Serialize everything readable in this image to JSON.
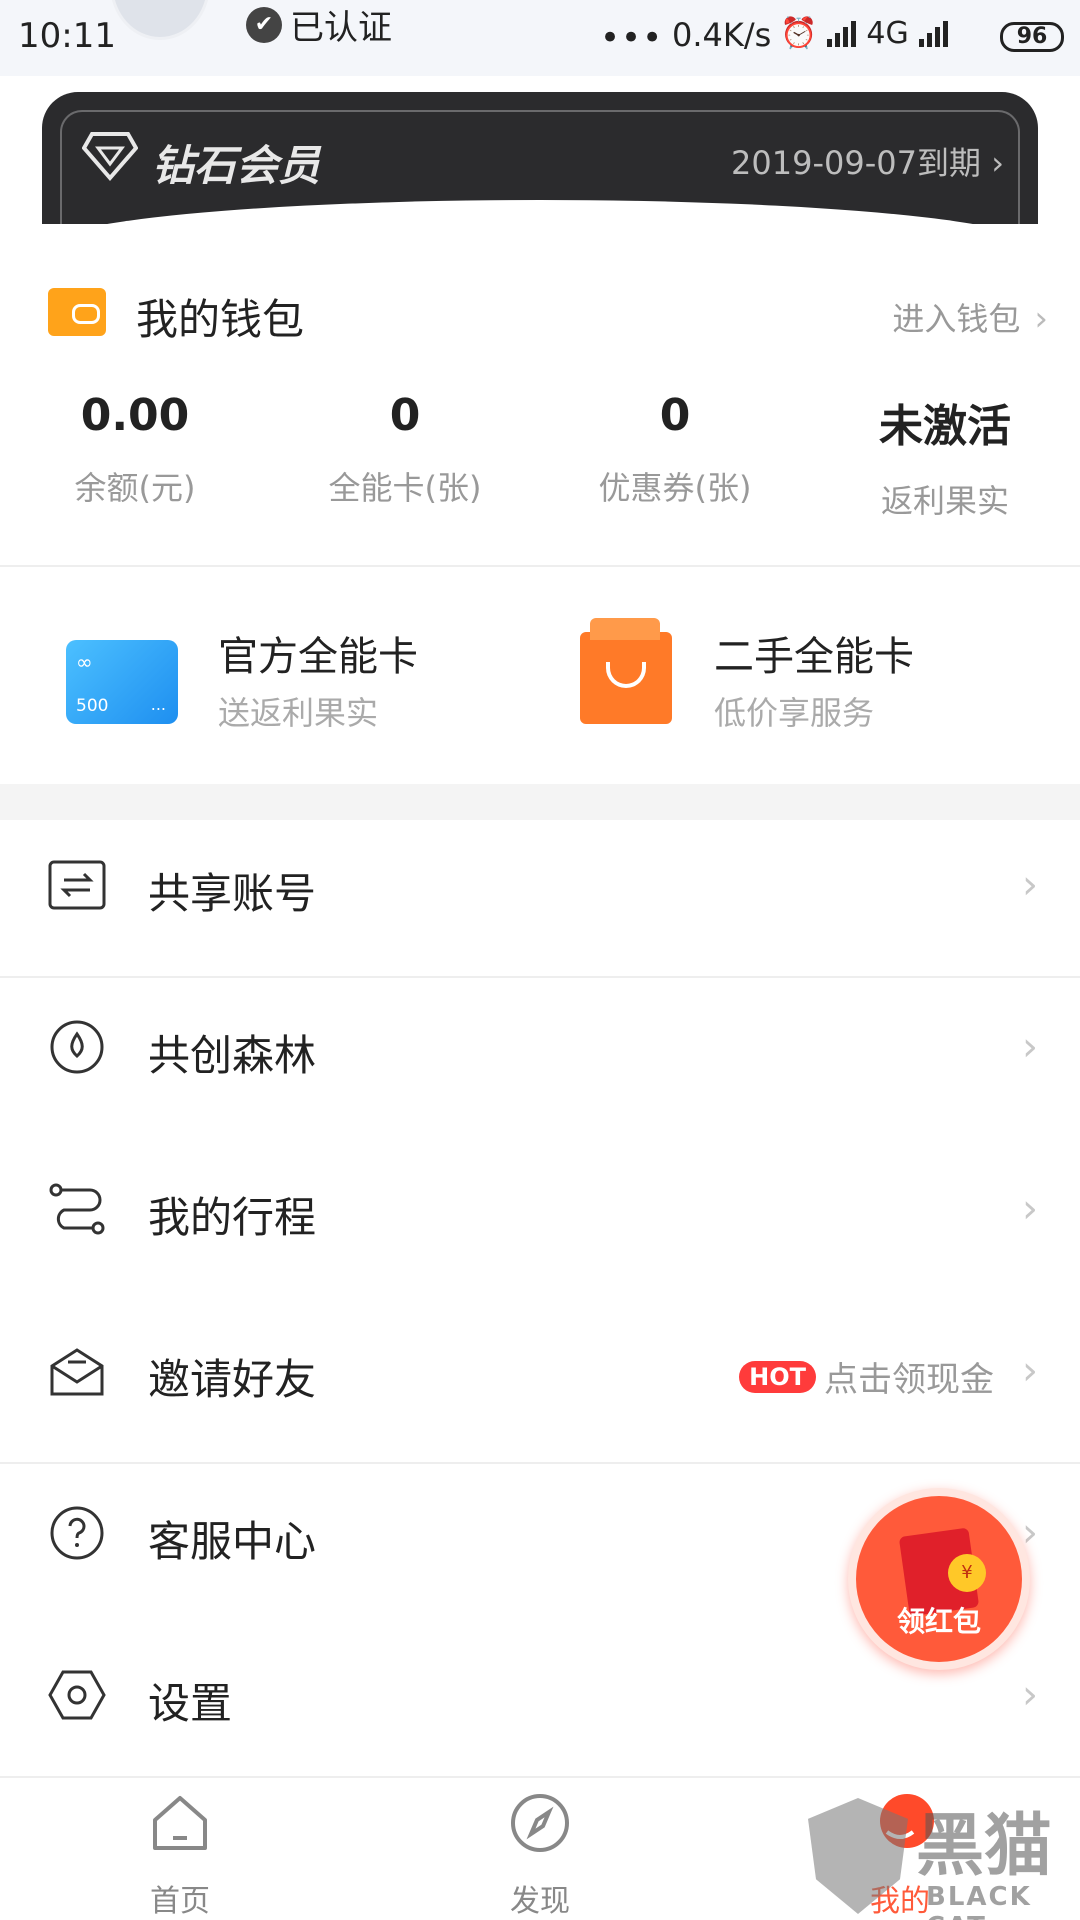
{
  "status_bar": {
    "time": "10:11",
    "verified_label": "已认证",
    "dots": "•••",
    "network_speed": "0.4K/s",
    "network_type": "4G",
    "battery": "96"
  },
  "vip": {
    "title": "钻石会员",
    "expiry": "2019-09-07到期 ›",
    "icon": "diamond-icon"
  },
  "wallet": {
    "title": "我的钱包",
    "enter_label": "进入钱包",
    "stats": [
      {
        "value": "0.00",
        "label": "余额(元)"
      },
      {
        "value": "0",
        "label": "全能卡(张)"
      },
      {
        "value": "0",
        "label": "优惠券(张)"
      },
      {
        "value": "未激活",
        "label": "返利果实"
      }
    ]
  },
  "cards": {
    "official": {
      "title": "官方全能卡",
      "subtitle": "送返利果实",
      "card_inf": "∞",
      "card_number": "500",
      "card_dots": "..."
    },
    "secondhand": {
      "title": "二手全能卡",
      "subtitle": "低价享服务"
    }
  },
  "menu": {
    "items": [
      {
        "label": "共享账号",
        "icon": "swap-icon"
      },
      {
        "label": "共创森林",
        "icon": "drop-icon"
      },
      {
        "label": "我的行程",
        "icon": "route-icon"
      },
      {
        "label": "邀请好友",
        "icon": "invite-icon",
        "hot": "HOT",
        "hint": "点击领现金"
      },
      {
        "label": "客服中心",
        "icon": "help-icon"
      },
      {
        "label": "设置",
        "icon": "settings-icon"
      }
    ],
    "arrow": "›"
  },
  "red_packet": {
    "label": "领红包",
    "coin": "¥"
  },
  "tabbar": {
    "tabs": [
      {
        "label": "首页",
        "icon": "home-icon"
      },
      {
        "label": "发现",
        "icon": "compass-icon"
      },
      {
        "label": "我的",
        "icon": "profile-icon"
      }
    ]
  },
  "watermark": {
    "cn": "黑猫",
    "en": "BLACK CAT"
  },
  "colors": {
    "accent": "#ff5a3a",
    "vip_bg": "#2b2b2d",
    "wallet": "#ffa31a"
  }
}
